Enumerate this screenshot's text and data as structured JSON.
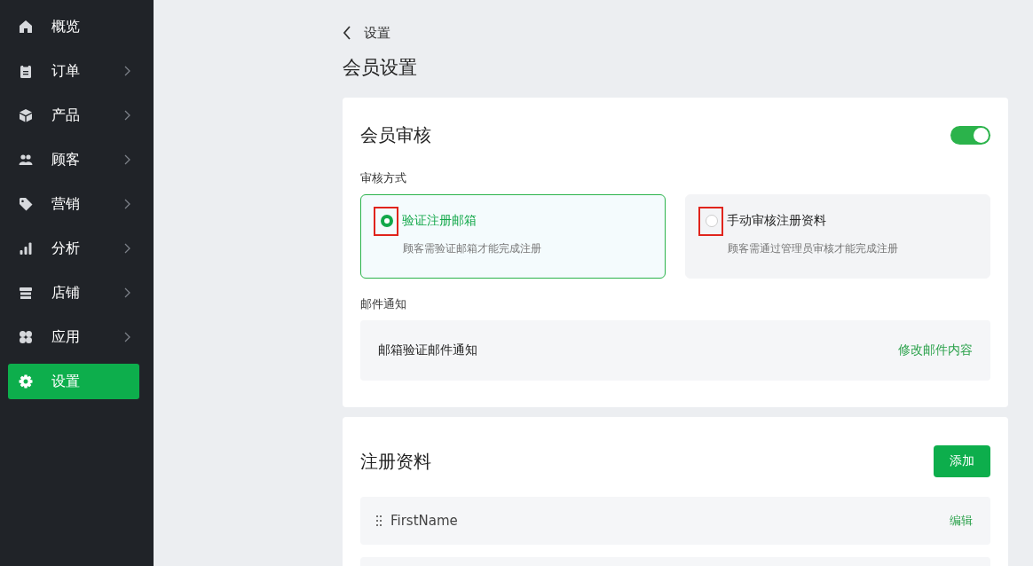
{
  "sidebar": {
    "items": [
      {
        "label": "概览",
        "expandable": false,
        "selected": false
      },
      {
        "label": "订单",
        "expandable": true,
        "selected": false
      },
      {
        "label": "产品",
        "expandable": true,
        "selected": false
      },
      {
        "label": "顾客",
        "expandable": true,
        "selected": false
      },
      {
        "label": "营销",
        "expandable": true,
        "selected": false
      },
      {
        "label": "分析",
        "expandable": true,
        "selected": false
      },
      {
        "label": "店铺",
        "expandable": true,
        "selected": false
      },
      {
        "label": "应用",
        "expandable": true,
        "selected": false
      },
      {
        "label": "设置",
        "expandable": false,
        "selected": true
      }
    ]
  },
  "back_link": "设置",
  "page_title": "会员设置",
  "review_card": {
    "title": "会员审核",
    "toggle": {
      "on": true
    },
    "method_label": "审核方式",
    "options": [
      {
        "label": "验证注册邮箱",
        "description": "顾客需验证邮箱才能完成注册",
        "selected": true,
        "highlighted": true
      },
      {
        "label": "手动审核注册资料",
        "description": "顾客需通过管理员审核才能完成注册",
        "selected": false,
        "highlighted": true
      }
    ],
    "email_label": "邮件通知",
    "email_row": {
      "label": "邮箱验证邮件通知",
      "action": "修改邮件内容"
    }
  },
  "fields_card": {
    "title": "注册资料",
    "add_button": "添加",
    "rows": [
      {
        "name": "FirstName",
        "action": "编辑"
      }
    ]
  }
}
